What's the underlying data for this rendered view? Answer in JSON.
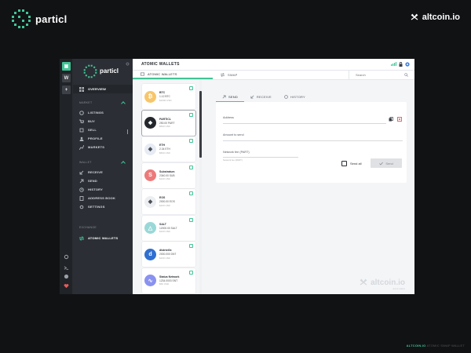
{
  "brand": {
    "name": "particl"
  },
  "watermark_top": {
    "name": "altcoin.io"
  },
  "rail": {
    "active": "▣",
    "w": "W",
    "add": "+"
  },
  "sidebar": {
    "logo": "particl",
    "overview": "OVERVIEW",
    "market_section": "MARKET",
    "market_items": [
      "LISTINGS",
      "BUY",
      "SELL",
      "PROFILE",
      "MARKETS"
    ],
    "wallet_section": "WALLET",
    "wallet_items": [
      "RECEIVE",
      "SEND",
      "HISTORY",
      "ADDRESS BOOK",
      "SETTINGS"
    ],
    "exchange_section": "EXCHANGE",
    "atomic": "ATOMIC WALLETS"
  },
  "topbar": {
    "title": "ATOMIC WALLETS"
  },
  "subtabs": {
    "atomic": "ATOMIC WALLETS",
    "swap": "SWAP",
    "search_placeholder": "Search"
  },
  "coins": [
    {
      "name": "BTC",
      "balance": "1.12 BTC",
      "fiat": "$1000 USD",
      "color": "#f7c66b",
      "glyph": "₿"
    },
    {
      "name": "PARTICL",
      "balance": "250.00 PART",
      "fiat": "$500 USD",
      "color": "#24272c",
      "glyph": "❖"
    },
    {
      "name": "ETH",
      "balance": "2.34 ETH",
      "fiat": "$500 USD",
      "color": "#e7ebf3",
      "glyph": "◆"
    },
    {
      "name": "Substratum",
      "balance": "2340.00 SUB",
      "fiat": "$100 USD",
      "color": "#ec7a7a",
      "glyph": "S"
    },
    {
      "name": "EOS",
      "balance": "2000.00 EOS",
      "fiat": "$100 USD",
      "color": "#eceef1",
      "glyph": "◆"
    },
    {
      "name": "SALT",
      "balance": "12000.00 SALT",
      "fiat": "$100 USD",
      "color": "#9ad8d8",
      "glyph": "△"
    },
    {
      "name": "district0x",
      "balance": "2000.000 DNT",
      "fiat": "$100 USD",
      "color": "#2f6fd1",
      "glyph": "d"
    },
    {
      "name": "Status Network",
      "balance": "1234.0003 SNT",
      "fiat": "$50 USD",
      "color": "#8a92f0",
      "glyph": "∿"
    }
  ],
  "panel": {
    "tabs": [
      "SEND",
      "RECEIVE",
      "HISTORY"
    ],
    "address_label": "Address",
    "amount_label": "Amount to send",
    "fee_label": "Network fee (PART)",
    "fee_hint": "Network fee (PART)",
    "send_all": "Send all",
    "send": "Send"
  },
  "watermark": {
    "name": "altcoin.io",
    "sub": "atomic wallets"
  },
  "footer": {
    "brand": "ALTCOIN.IO",
    "rest": "     ATOMIC SWAP WALLET"
  },
  "colors": {
    "accent": "#41c496",
    "sidebar": "#2b2f35",
    "rail": "#202327"
  }
}
